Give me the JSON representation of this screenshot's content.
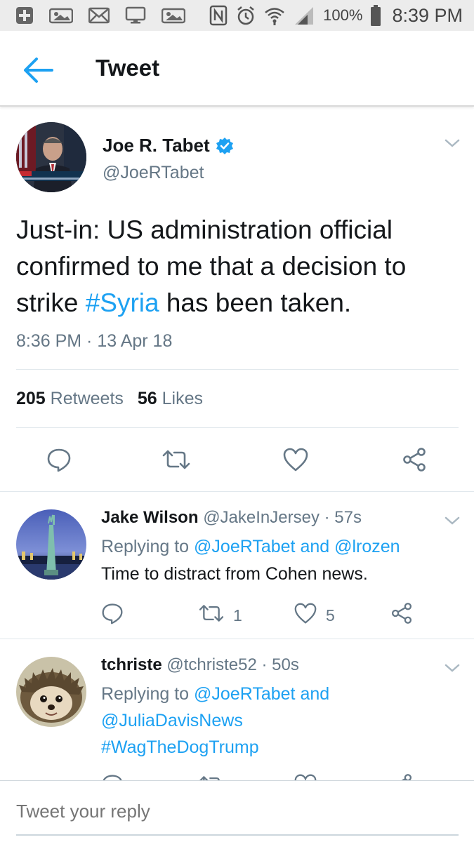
{
  "status_bar": {
    "battery_percent": "100%",
    "time": "8:39 PM",
    "icons": [
      "add-icon",
      "photo-icon",
      "mail-icon",
      "screen-icon",
      "photo-icon",
      "nfc-icon",
      "alarm-icon",
      "wifi-icon",
      "signal-icon",
      "battery-icon"
    ]
  },
  "header": {
    "title": "Tweet"
  },
  "tweet": {
    "author_name": "Joe R. Tabet",
    "author_handle": "@JoeRTabet",
    "text_before": "Just-in: US administration official confirmed to me that a decision to strike ",
    "hashtag": "#Syria",
    "text_after": " has been taken.",
    "timestamp": "8:36 PM · 13 Apr 18",
    "retweet_count": "205",
    "retweet_label": "Retweets",
    "like_count": "56",
    "like_label": "Likes"
  },
  "replies": [
    {
      "name": "Jake Wilson",
      "handle": "@JakeInJersey",
      "age": "· 57s",
      "replying_prefix": "Replying to",
      "mention_1": "@JoeRTabet",
      "connector": "and",
      "mention_2": "@lrozen",
      "text": "Time to distract from Cohen news.",
      "retweets": "1",
      "likes": "5"
    },
    {
      "name": "tchriste",
      "handle": "@tchriste52",
      "age": "· 50s",
      "replying_prefix": "Replying to",
      "mention_1": "@JoeRTabet",
      "connector": "and",
      "mention_2": "@JuliaDavisNews",
      "hashtag": "#WagTheDogTrump"
    }
  ],
  "compose": {
    "placeholder": "Tweet your reply"
  },
  "colors": {
    "accent": "#1da1f2",
    "secondary_text": "#657786",
    "primary_text": "#14171a"
  }
}
